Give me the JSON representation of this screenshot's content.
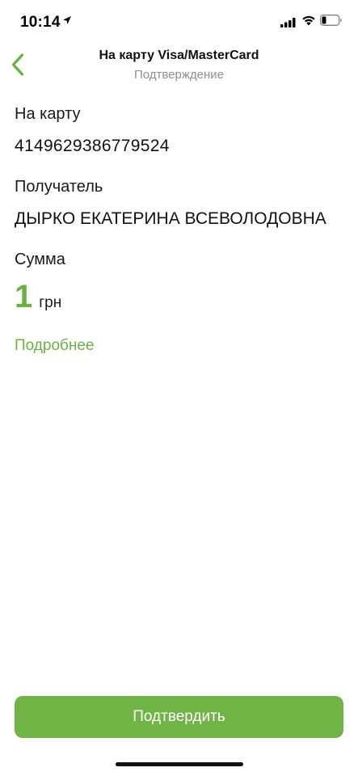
{
  "status_bar": {
    "time": "10:14"
  },
  "nav": {
    "title": "На карту Visa/MasterCard",
    "subtitle": "Подтверждение"
  },
  "fields": {
    "card_label": "На карту",
    "card_number": "4149629386779524",
    "recipient_label": "Получатель",
    "recipient_name": "ДЫРКО ЕКАТЕРИНА ВСЕВОЛОДОВНА",
    "amount_label": "Сумма",
    "amount_value": "1",
    "amount_currency": "грн"
  },
  "details_link": "Подробнее",
  "confirm_button": "Подтвердить",
  "colors": {
    "accent": "#6cb13f",
    "button": "#70b446",
    "subtitle": "#8e8e93"
  }
}
